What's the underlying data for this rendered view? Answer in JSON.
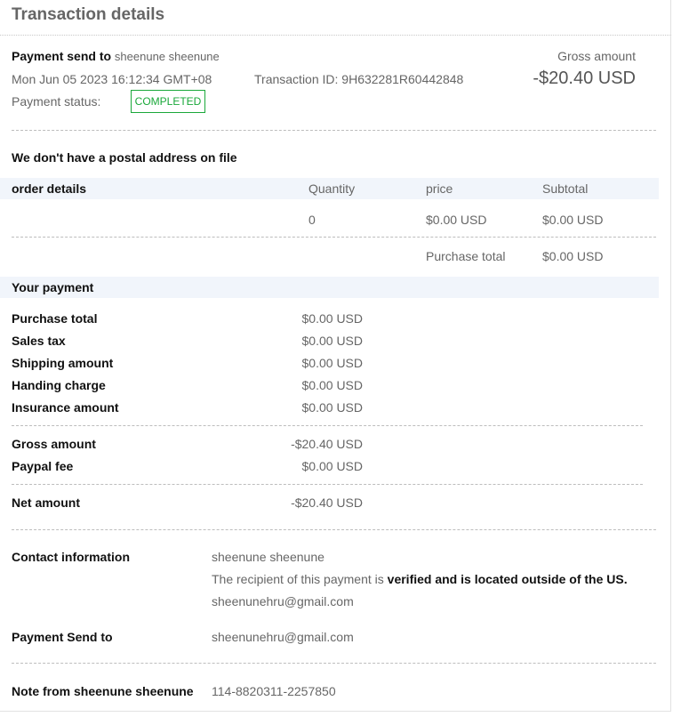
{
  "header": {
    "title": "Transaction details"
  },
  "summary": {
    "payment_send_to_label": "Payment send to",
    "payment_send_to_name": "sheenune sheenune",
    "date": "Mon Jun 05 2023 16:12:34 GMT+08",
    "transaction_id_label": "Transaction ID:",
    "transaction_id": "9H632281R60442848",
    "payment_status_label": "Payment status:",
    "payment_status": "COMPLETED",
    "gross_amount_label": "Gross amount",
    "gross_amount": "-$20.40 USD"
  },
  "postal_note": "We don't have a postal address on file",
  "order": {
    "columns": {
      "details": "order details",
      "quantity": "Quantity",
      "price": "price",
      "subtotal": "Subtotal"
    },
    "row": {
      "details": "",
      "quantity": "0",
      "price": "$0.00 USD",
      "subtotal": "$0.00 USD"
    },
    "purchase_total_label": "Purchase total",
    "purchase_total": "$0.00 USD"
  },
  "your_payment": {
    "title": "Your payment",
    "items": [
      {
        "label": "Purchase total",
        "value": "$0.00 USD"
      },
      {
        "label": "Sales tax",
        "value": "$0.00 USD"
      },
      {
        "label": "Shipping amount",
        "value": "$0.00 USD"
      },
      {
        "label": "Handing charge",
        "value": "$0.00 USD"
      },
      {
        "label": "Insurance amount",
        "value": "$0.00 USD"
      }
    ],
    "gross_label": "Gross amount",
    "gross_value": "-$20.40 USD",
    "fee_label": "Paypal fee",
    "fee_value": "$0.00 USD",
    "net_label": "Net amount",
    "net_value": "-$20.40 USD"
  },
  "contact": {
    "label": "Contact information",
    "name": "sheenune sheenune",
    "recipient_prefix": "The recipient of this payment is ",
    "recipient_bold": "verified and is located outside of the US.",
    "email": "sheenunehru@gmail.com"
  },
  "payment_send_to": {
    "label": "Payment Send to",
    "email": "sheenunehru@gmail.com"
  },
  "note": {
    "label": "Note from sheenune sheenune",
    "text": "114-8820311-2257850"
  }
}
